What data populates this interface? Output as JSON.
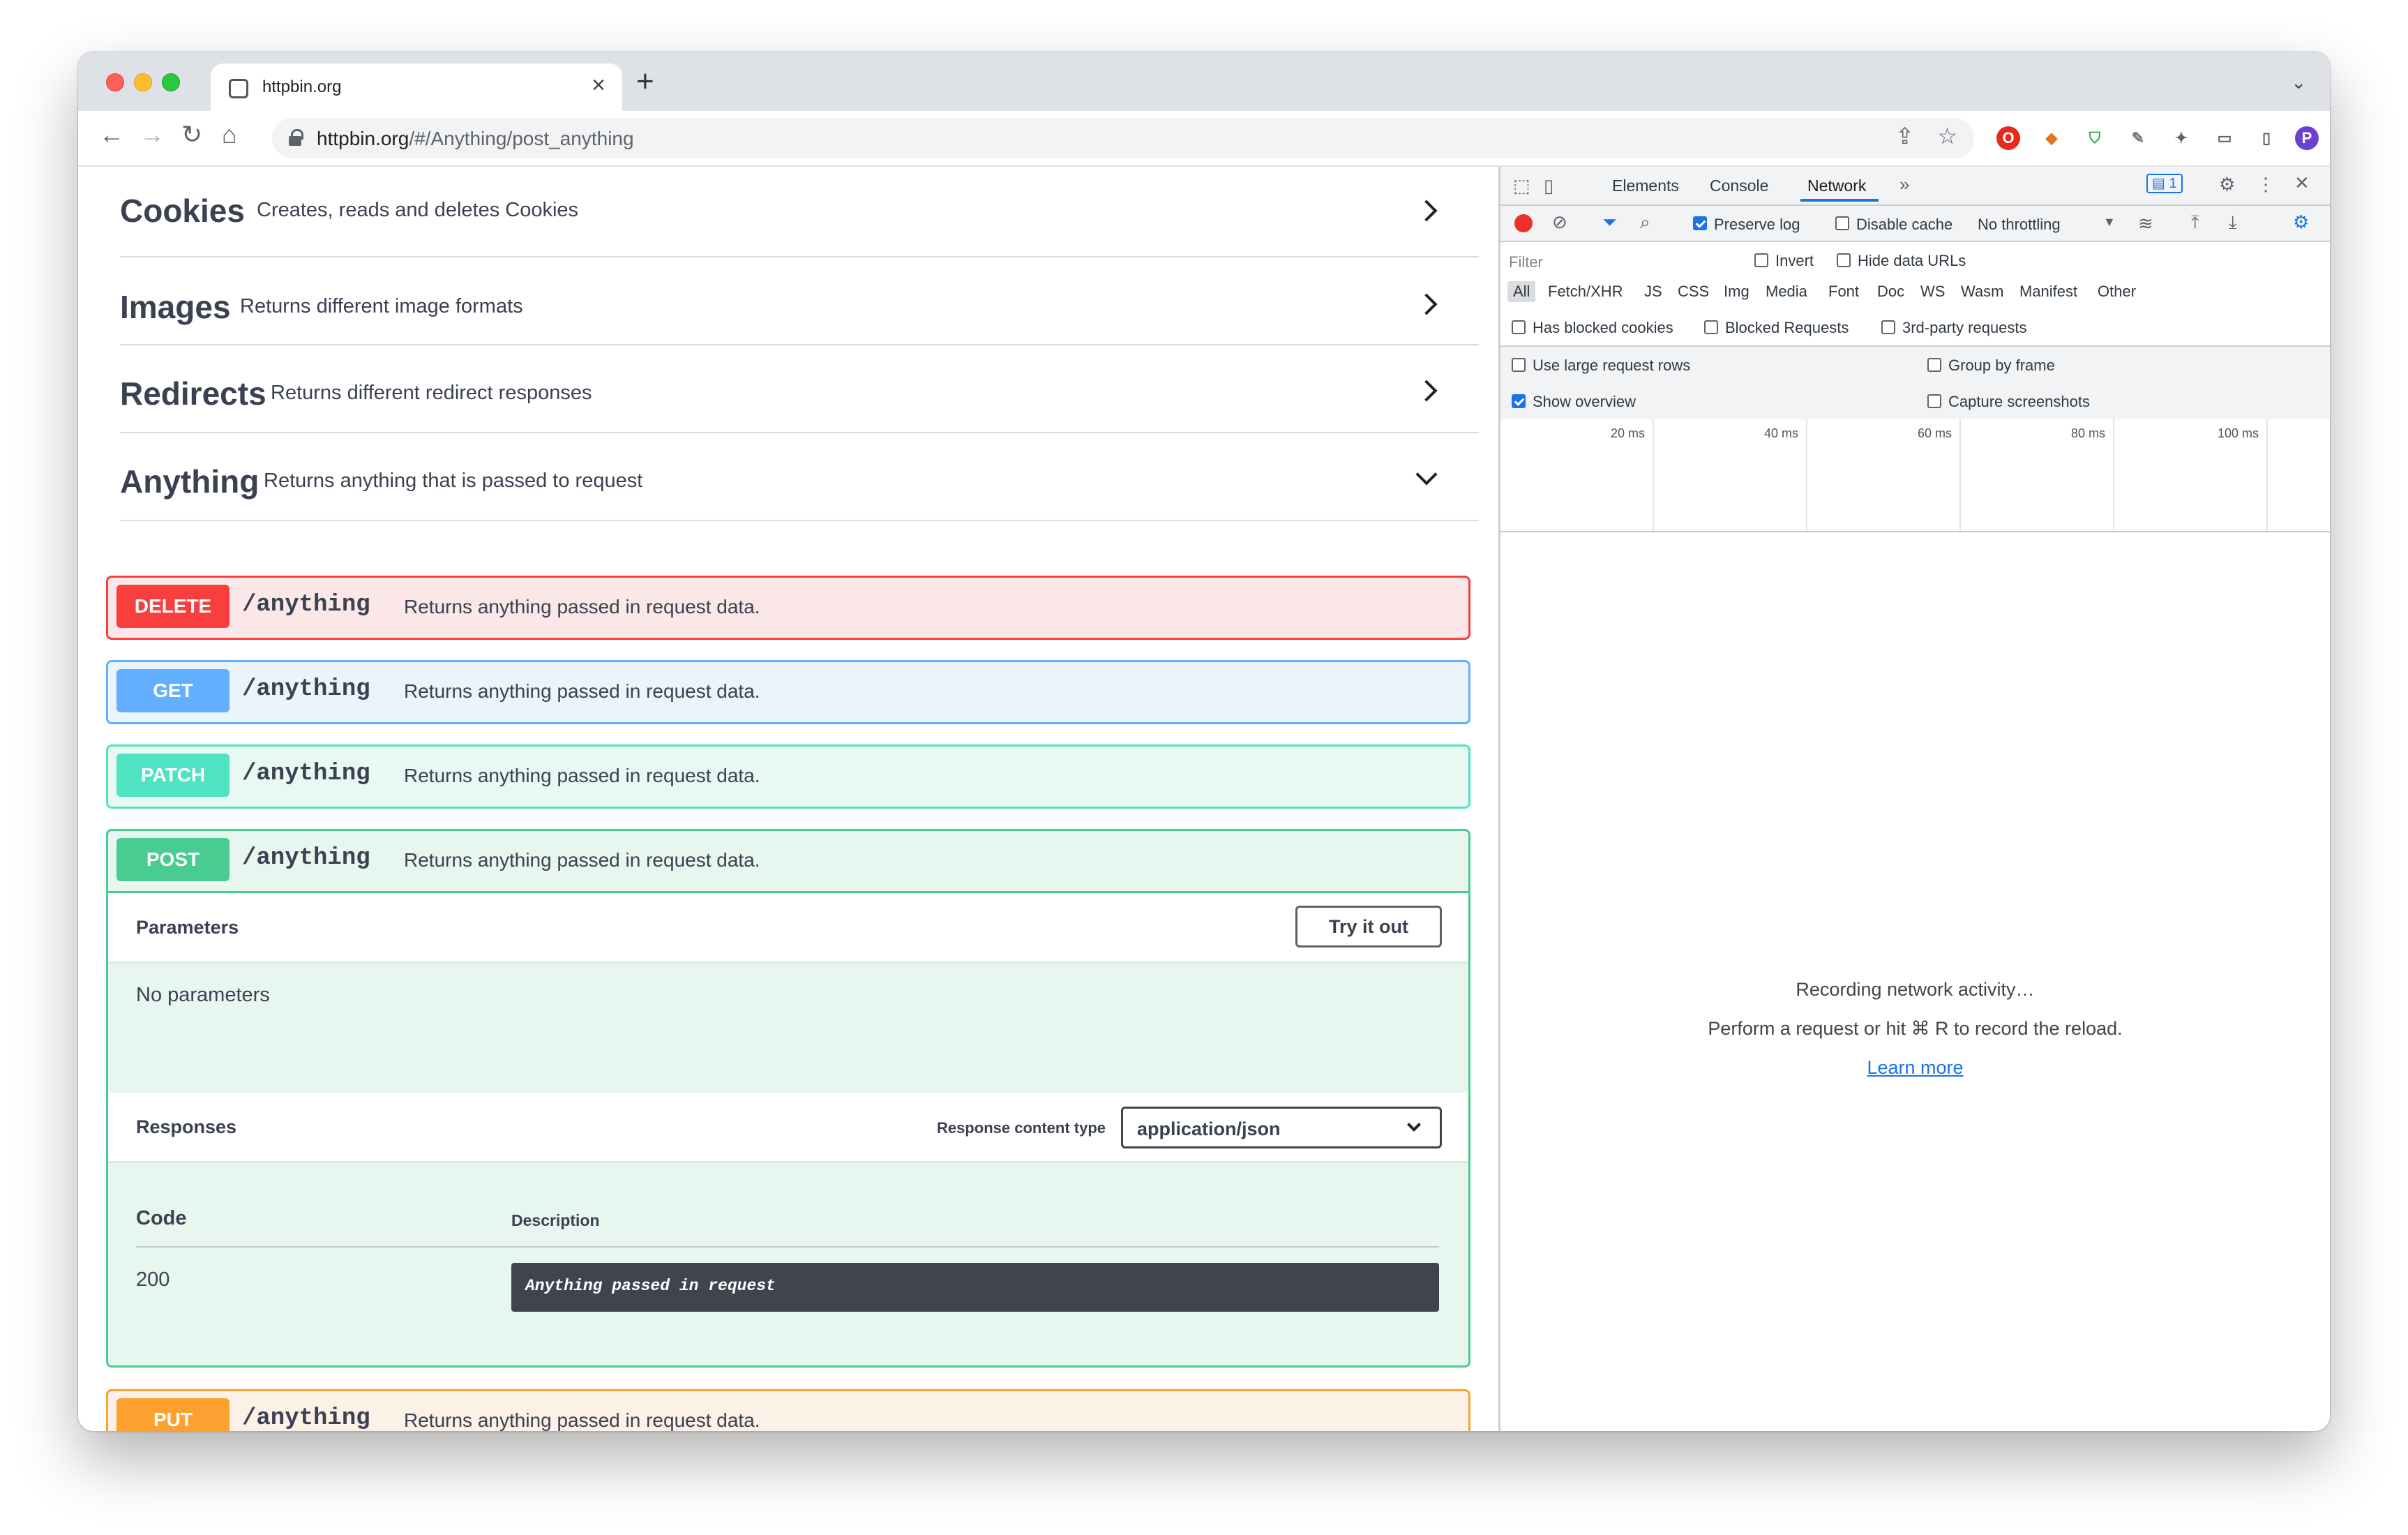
{
  "browser": {
    "tab_title": "httpbin.org",
    "url_host": "httpbin.org",
    "url_path": "/#/Anything/post_anything",
    "profile_initial": "P"
  },
  "sections": [
    {
      "name": "Cookies",
      "description": "Creates, reads and deletes Cookies"
    },
    {
      "name": "Images",
      "description": "Returns different image formats"
    },
    {
      "name": "Redirects",
      "description": "Returns different redirect responses"
    },
    {
      "name": "Anything",
      "description": "Returns anything that is passed to request"
    }
  ],
  "operations": [
    {
      "method": "DELETE",
      "path": "/anything",
      "summary": "Returns anything passed in request data."
    },
    {
      "method": "GET",
      "path": "/anything",
      "summary": "Returns anything passed in request data."
    },
    {
      "method": "PATCH",
      "path": "/anything",
      "summary": "Returns anything passed in request data."
    },
    {
      "method": "POST",
      "path": "/anything",
      "summary": "Returns anything passed in request data."
    },
    {
      "method": "PUT",
      "path": "/anything",
      "summary": "Returns anything passed in request data."
    }
  ],
  "post_detail": {
    "parameters_label": "Parameters",
    "try_button": "Try it out",
    "no_parameters": "No parameters",
    "responses_label": "Responses",
    "response_content_type_label": "Response content type",
    "response_content_type_value": "application/json",
    "col_code": "Code",
    "col_description": "Description",
    "rows": [
      {
        "code": "200",
        "description": "Anything passed in request"
      }
    ]
  },
  "devtools": {
    "tabs": [
      "Elements",
      "Console",
      "Network"
    ],
    "active_tab": "Network",
    "issues_count": "1",
    "preserve_log": "Preserve log",
    "disable_cache": "Disable cache",
    "throttling": "No throttling",
    "filter_placeholder": "Filter",
    "invert": "Invert",
    "hide_data_urls": "Hide data URLs",
    "filter_types": [
      "All",
      "Fetch/XHR",
      "JS",
      "CSS",
      "Img",
      "Media",
      "Font",
      "Doc",
      "WS",
      "Wasm",
      "Manifest",
      "Other"
    ],
    "has_blocked_cookies": "Has blocked cookies",
    "blocked_requests": "Blocked Requests",
    "third_party": "3rd-party requests",
    "large_rows": "Use large request rows",
    "group_by_frame": "Group by frame",
    "show_overview": "Show overview",
    "capture_screenshots": "Capture screenshots",
    "timeline_ticks": [
      "20 ms",
      "40 ms",
      "60 ms",
      "80 ms",
      "100 ms"
    ],
    "recording": "Recording network activity…",
    "perform_hint": "Perform a request or hit ⌘ R to record the reload.",
    "learn_more": "Learn more"
  },
  "colors": {
    "delete": "#f93e3e",
    "get": "#61affe",
    "patch": "#50e3c2",
    "post": "#49cc90",
    "put": "#fca130",
    "devtools_accent": "#1a73e8"
  }
}
